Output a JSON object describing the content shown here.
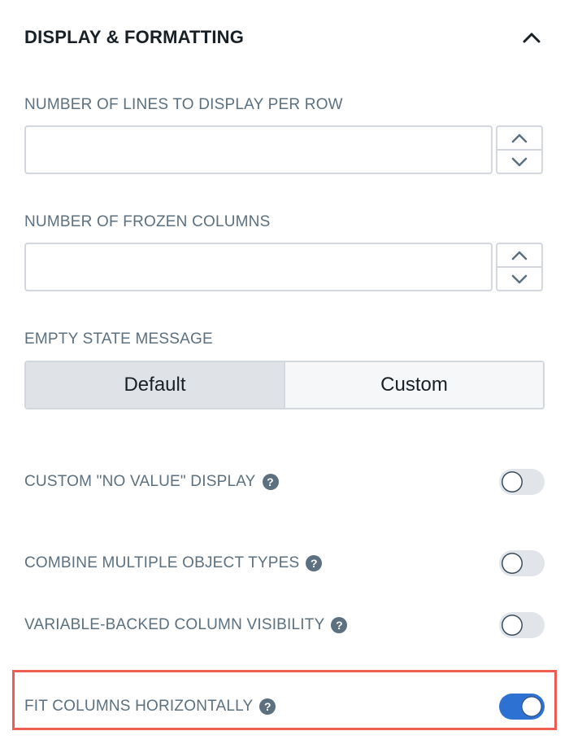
{
  "section": {
    "title": "DISPLAY & FORMATTING"
  },
  "fields": {
    "lines_per_row": {
      "label": "NUMBER OF LINES TO DISPLAY PER ROW",
      "value": ""
    },
    "frozen_columns": {
      "label": "NUMBER OF FROZEN COLUMNS",
      "value": ""
    }
  },
  "empty_state": {
    "label": "EMPTY STATE MESSAGE",
    "options": [
      "Default",
      "Custom"
    ],
    "selected": "Default"
  },
  "toggles": [
    {
      "label": "CUSTOM \"NO VALUE\" DISPLAY",
      "on": false
    },
    {
      "label": "COMBINE MULTIPLE OBJECT TYPES",
      "on": false
    },
    {
      "label": "VARIABLE-BACKED COLUMN VISIBILITY",
      "on": false
    },
    {
      "label": "FIT COLUMNS HORIZONTALLY",
      "on": true
    }
  ],
  "colors": {
    "accent": "#2d72d2",
    "highlight": "#ee5d52"
  },
  "icons": {
    "collapse": "chevron-up-icon",
    "increment": "chevron-up-icon",
    "decrement": "chevron-down-icon",
    "help": "help-icon"
  }
}
